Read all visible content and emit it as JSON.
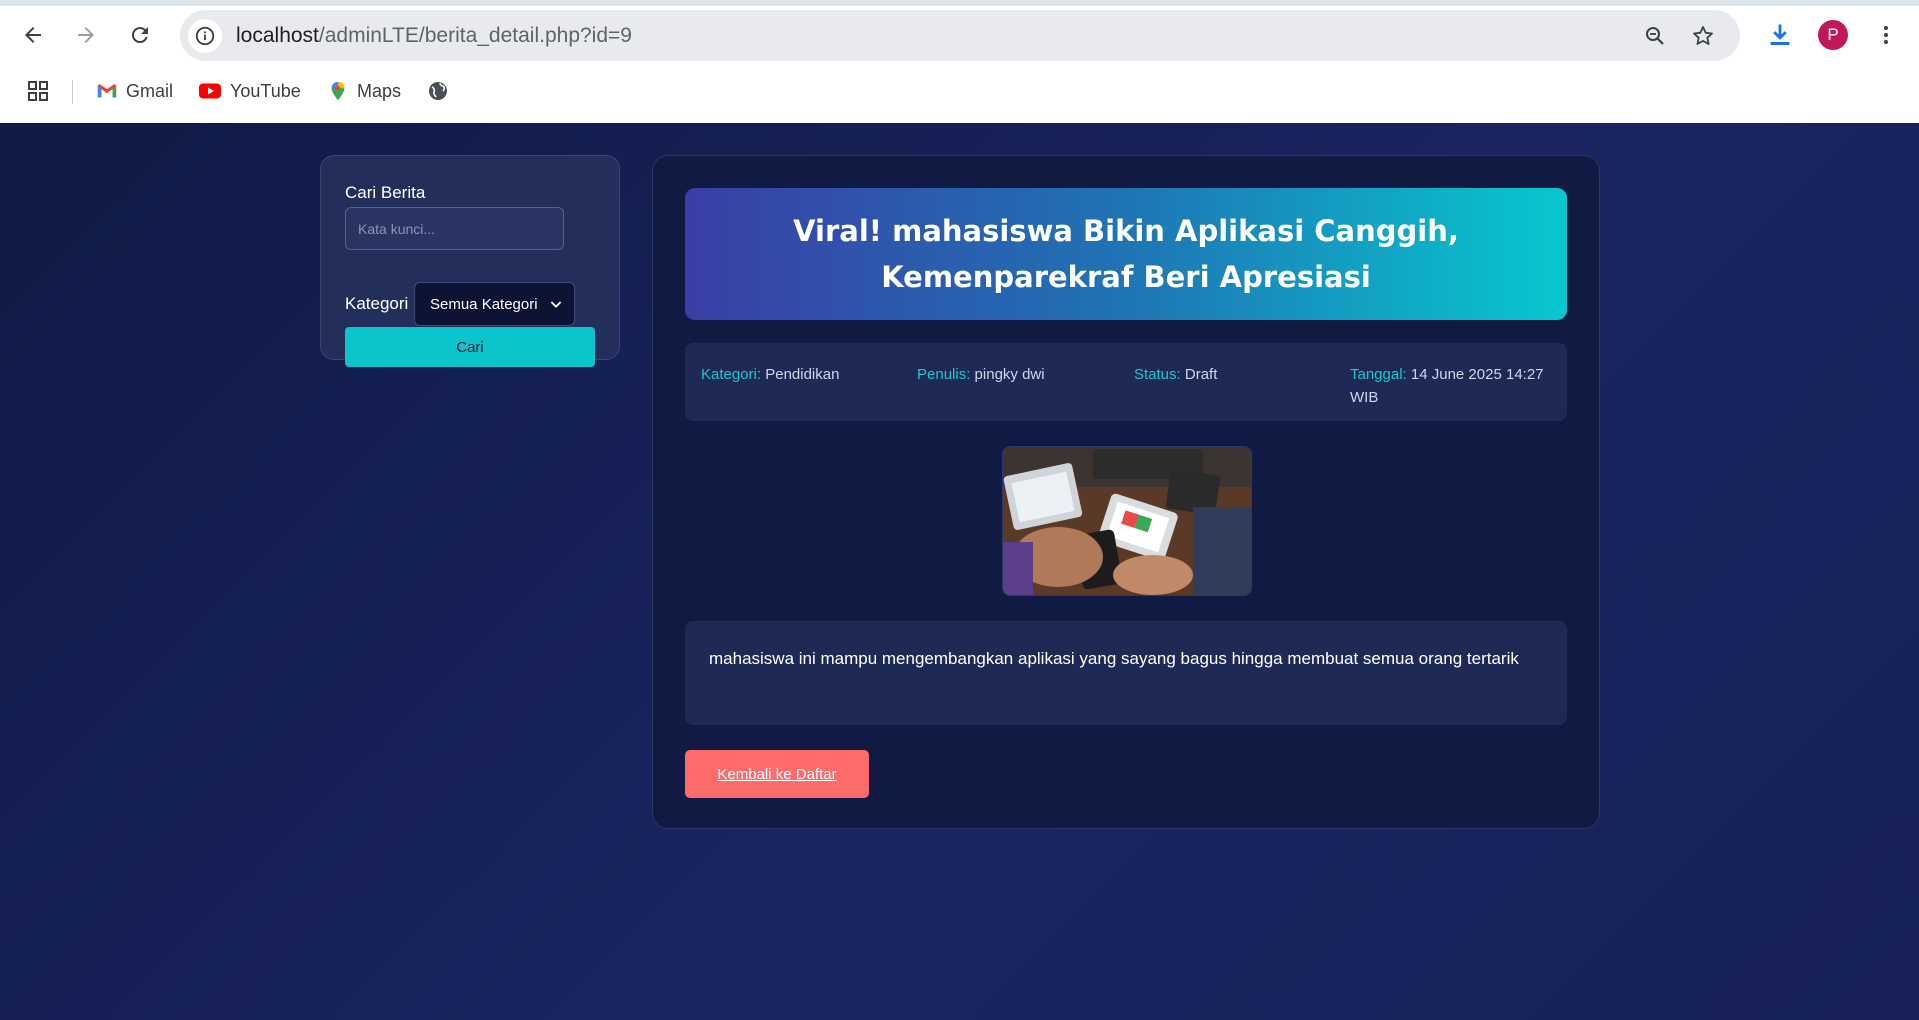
{
  "browser": {
    "url_host": "localhost",
    "url_path": "/adminLTE/berita_detail.php?id=9",
    "profile_initial": "P",
    "bookmarks": [
      {
        "label": "Gmail",
        "icon": "gmail-icon"
      },
      {
        "label": "YouTube",
        "icon": "youtube-icon"
      },
      {
        "label": "Maps",
        "icon": "maps-icon"
      }
    ]
  },
  "search": {
    "title": "Cari Berita",
    "input_placeholder": "Kata kunci...",
    "input_value": "",
    "category_label": "Kategori",
    "category_selected": "Semua Kategori",
    "submit_label": "Cari"
  },
  "article": {
    "title": "Viral! mahasiswa Bikin Aplikasi Canggih, Kemenparekraf Beri Apresiasi",
    "meta": {
      "kategori_label": "Kategori:",
      "kategori": "Pendidikan",
      "penulis_label": "Penulis:",
      "penulis": "pingky dwi",
      "status_label": "Status:",
      "status": "Draft",
      "tanggal_label": "Tanggal:",
      "tanggal": "14 June 2025 14:27 WIB"
    },
    "body": "mahasiswa ini mampu mengembangkan aplikasi yang sayang bagus hingga membuat semua orang tertarik",
    "back_label": "Kembali ke Daftar"
  },
  "colors": {
    "accent": "#0bc4cc",
    "danger": "#ff6b6b",
    "background": "#16204d",
    "card": "#101a42"
  }
}
